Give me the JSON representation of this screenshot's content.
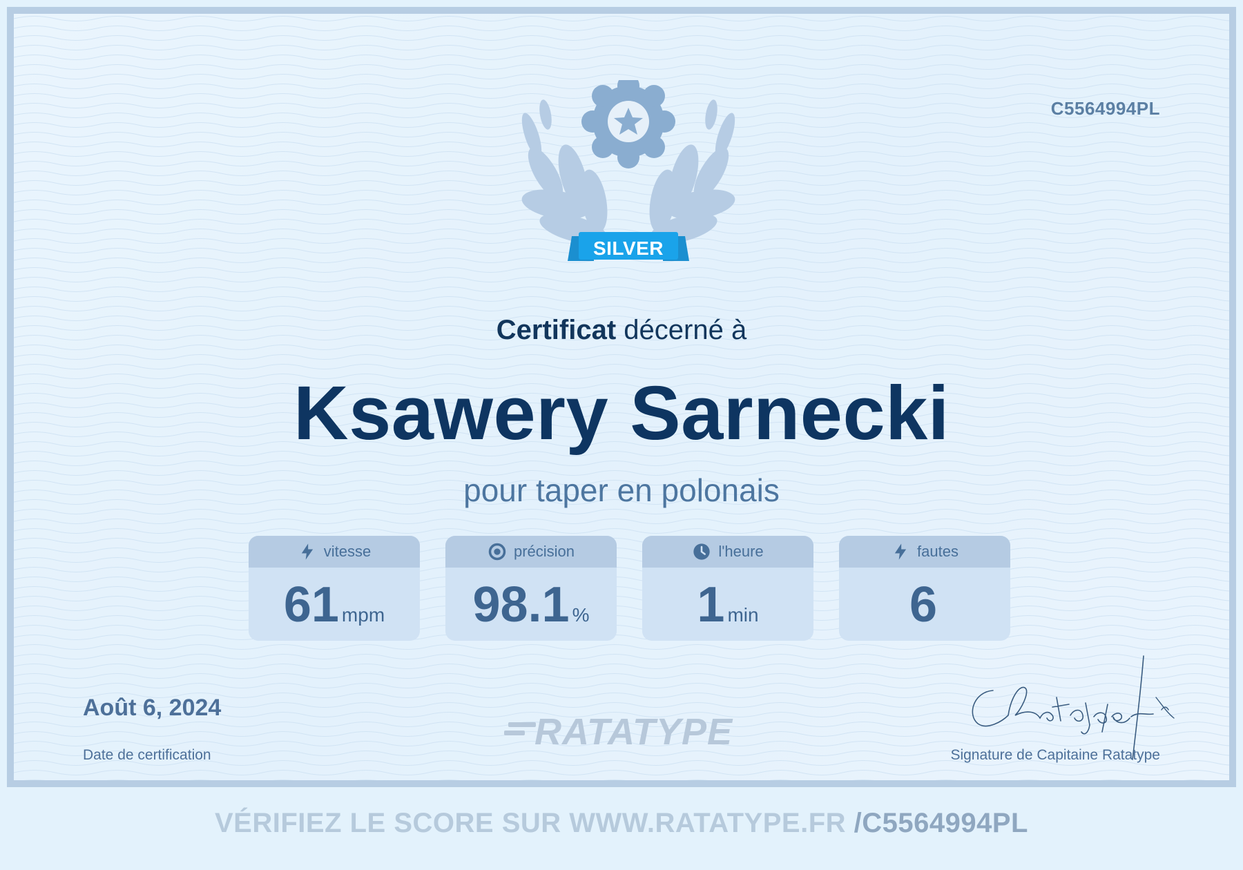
{
  "certificate": {
    "id": "C5564994PL",
    "badge": "SILVER",
    "headline_strong": "Certificat",
    "headline_rest": "décerné à",
    "recipient": "Ksawery Sarnecki",
    "subtitle": "pour taper en polonais",
    "stats": [
      {
        "icon": "lightning-icon",
        "label": "vitesse",
        "value": "61",
        "unit": "mpm"
      },
      {
        "icon": "target-icon",
        "label": "précision",
        "value": "98.1",
        "unit": "%"
      },
      {
        "icon": "clock-icon",
        "label": "l'heure",
        "value": "1",
        "unit": "min"
      },
      {
        "icon": "lightning-icon",
        "label": "fautes",
        "value": "6",
        "unit": ""
      }
    ],
    "date": "Août 6, 2024",
    "date_label": "Date de certification",
    "brand": "RATATYPE",
    "signature_label": "Signature de Capitaine Ratatype"
  },
  "footer": {
    "verify_text": "VÉRIFIEZ LE SCORE SUR WWW.RATATYPE.FR",
    "verify_code": "/C5564994PL"
  },
  "colors": {
    "frame": "#b7cde3",
    "background": "#e3f2fc",
    "name": "#0e3561",
    "badge_ribbon": "#1aa3ea",
    "medal": "#8aadd0"
  }
}
